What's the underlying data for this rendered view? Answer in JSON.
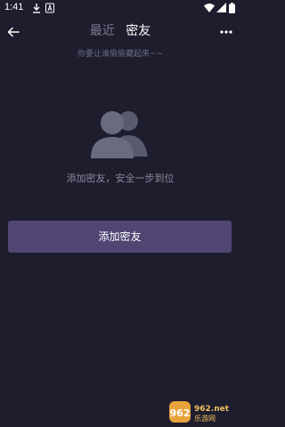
{
  "status_bar": {
    "time": "1:41",
    "icons": [
      "download-icon",
      "a-notification-icon",
      "wifi-icon",
      "signal-icon",
      "battery-icon"
    ]
  },
  "header": {
    "back_icon": "back-arrow-icon",
    "tabs": [
      {
        "label": "最近",
        "active": false
      },
      {
        "label": "密友",
        "active": true
      }
    ],
    "more_icon": "more-dots-icon"
  },
  "subtitle": "你要让谁偷偷藏起来~~",
  "empty_state": {
    "icon": "contacts-group-icon",
    "text": "添加密友，安全一步到位"
  },
  "add_button": {
    "label": "添加密友"
  },
  "watermark": {
    "text": "962.net",
    "subtext": "乐游网"
  },
  "colors": {
    "background": "#1d1d2e",
    "button": "#504573",
    "icon": "#6b6b80",
    "inactive_tab": "#7a7a8c",
    "muted_text": "#8a8a9c"
  }
}
